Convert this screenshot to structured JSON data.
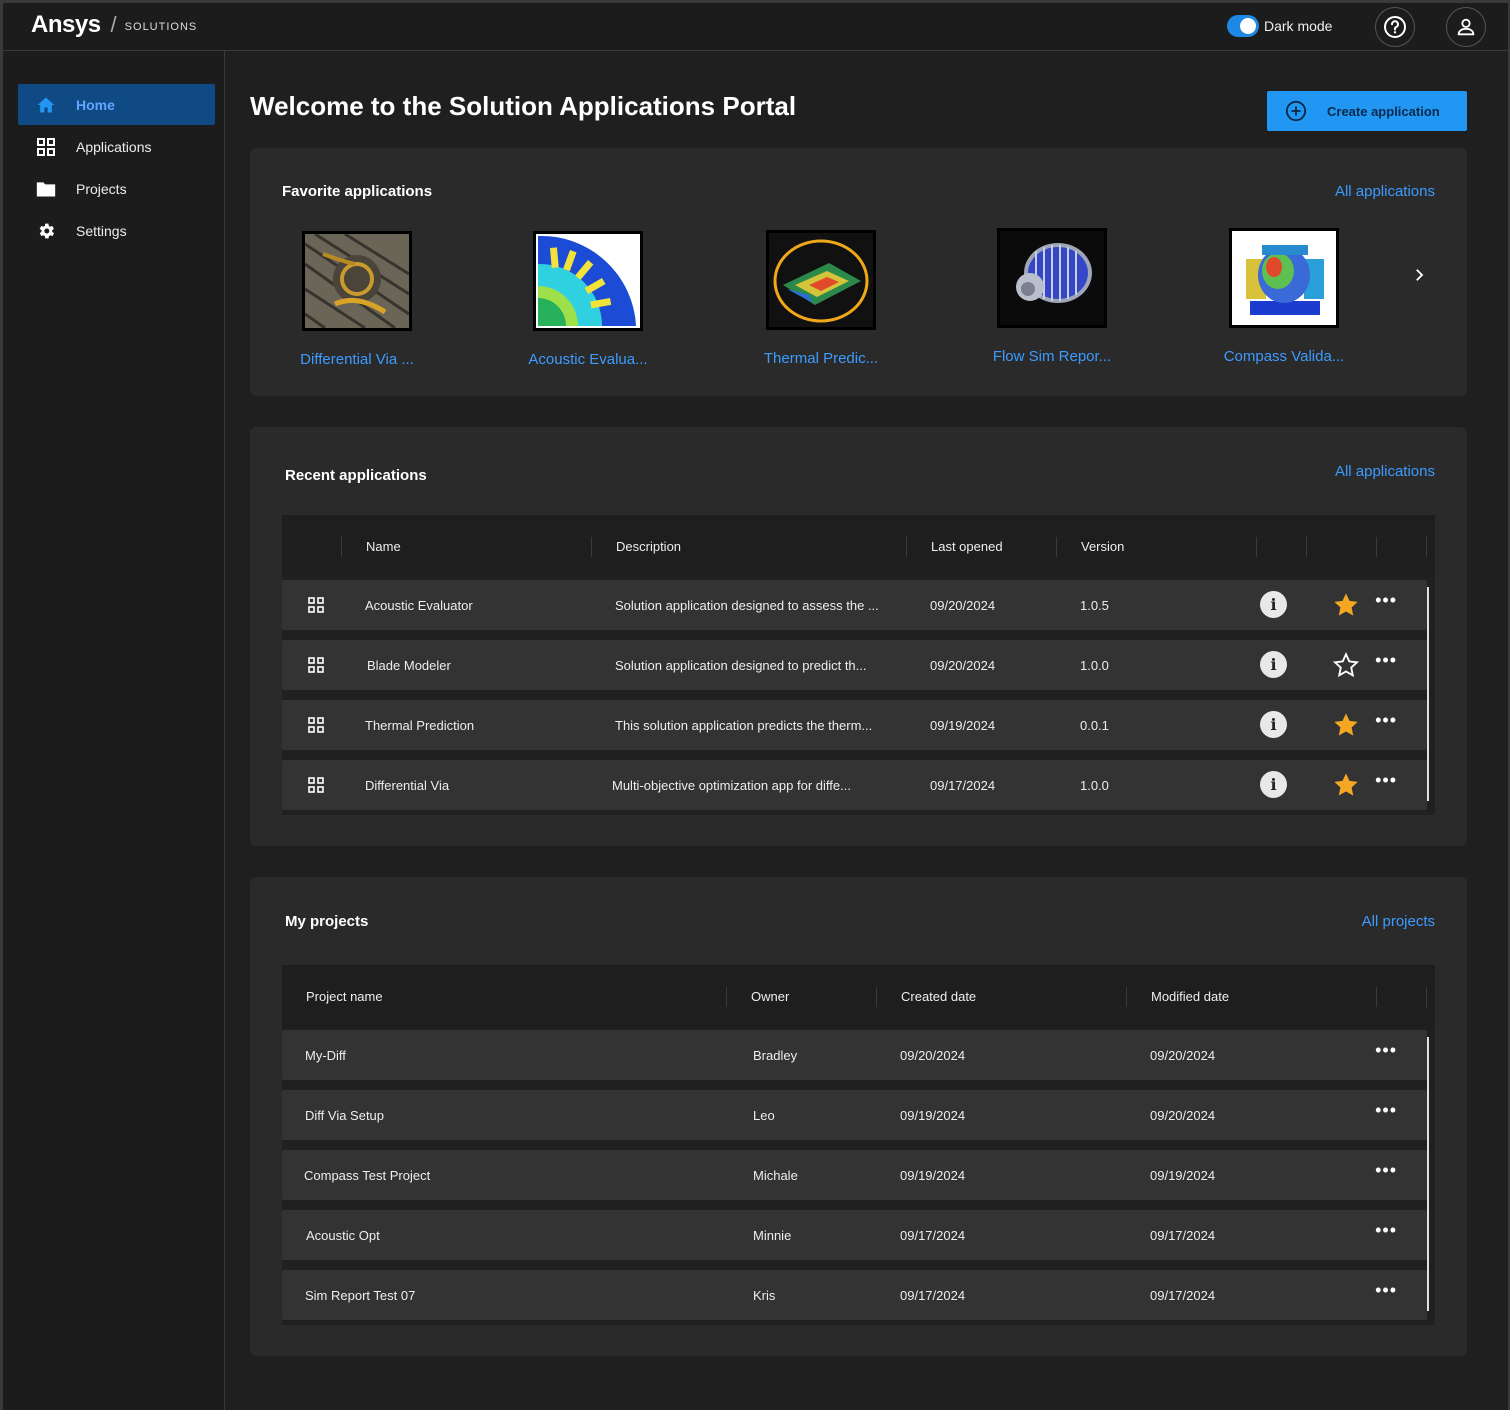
{
  "header": {
    "brand": "Ansys",
    "brand_sub": "SOLUTIONS",
    "dark_mode_label": "Dark mode",
    "dark_mode_on": true
  },
  "sidebar": {
    "items": [
      {
        "label": "Home",
        "icon": "home-icon",
        "active": true
      },
      {
        "label": "Applications",
        "icon": "grid-icon",
        "active": false
      },
      {
        "label": "Projects",
        "icon": "folder-icon",
        "active": false
      },
      {
        "label": "Settings",
        "icon": "gear-icon",
        "active": false
      }
    ]
  },
  "main": {
    "title": "Welcome to the Solution Applications Portal",
    "create_button": "Create application"
  },
  "favorites": {
    "title": "Favorite applications",
    "link": "All applications",
    "items": [
      {
        "name": "Differential Via ..."
      },
      {
        "name": "Acoustic Evalua..."
      },
      {
        "name": "Thermal Predic..."
      },
      {
        "name": "Flow Sim Repor..."
      },
      {
        "name": "Compass Valida..."
      }
    ]
  },
  "recent": {
    "title": "Recent applications",
    "link": "All applications",
    "columns": [
      "Name",
      "Description",
      "Last opened",
      "Version"
    ],
    "rows": [
      {
        "name": "Acoustic Evaluator",
        "description": "Solution application designed to assess the ...",
        "last_opened": "09/20/2024",
        "version": "1.0.5",
        "favorite": true
      },
      {
        "name": "Blade Modeler",
        "description": "Solution application designed to predict th...",
        "last_opened": "09/20/2024",
        "version": "1.0.0",
        "favorite": false
      },
      {
        "name": "Thermal Prediction",
        "description": "This solution application predicts the therm...",
        "last_opened": "09/19/2024",
        "version": "0.0.1",
        "favorite": true
      },
      {
        "name": "Differential Via",
        "description": "Multi-objective optimization app for diffe...",
        "last_opened": "09/17/2024",
        "version": "1.0.0",
        "favorite": true
      }
    ]
  },
  "projects": {
    "title": "My projects",
    "link": "All projects",
    "columns": [
      "Project name",
      "Owner",
      "Created date",
      "Modified date"
    ],
    "rows": [
      {
        "name": "My-Diff",
        "owner": "Bradley",
        "created": "09/20/2024",
        "modified": "09/20/2024"
      },
      {
        "name": "Diff Via Setup",
        "owner": "Leo",
        "created": "09/19/2024",
        "modified": "09/20/2024"
      },
      {
        "name": "Compass Test Project",
        "owner": "Michale",
        "created": "09/19/2024",
        "modified": "09/19/2024"
      },
      {
        "name": "Acoustic Opt",
        "owner": "Minnie",
        "created": "09/17/2024",
        "modified": "09/17/2024"
      },
      {
        "name": "Sim Report Test 07",
        "owner": "Kris",
        "created": "09/17/2024",
        "modified": "09/17/2024"
      }
    ]
  },
  "colors": {
    "accent": "#2196f3",
    "link": "#3d9bff",
    "star": "#f5a623"
  }
}
